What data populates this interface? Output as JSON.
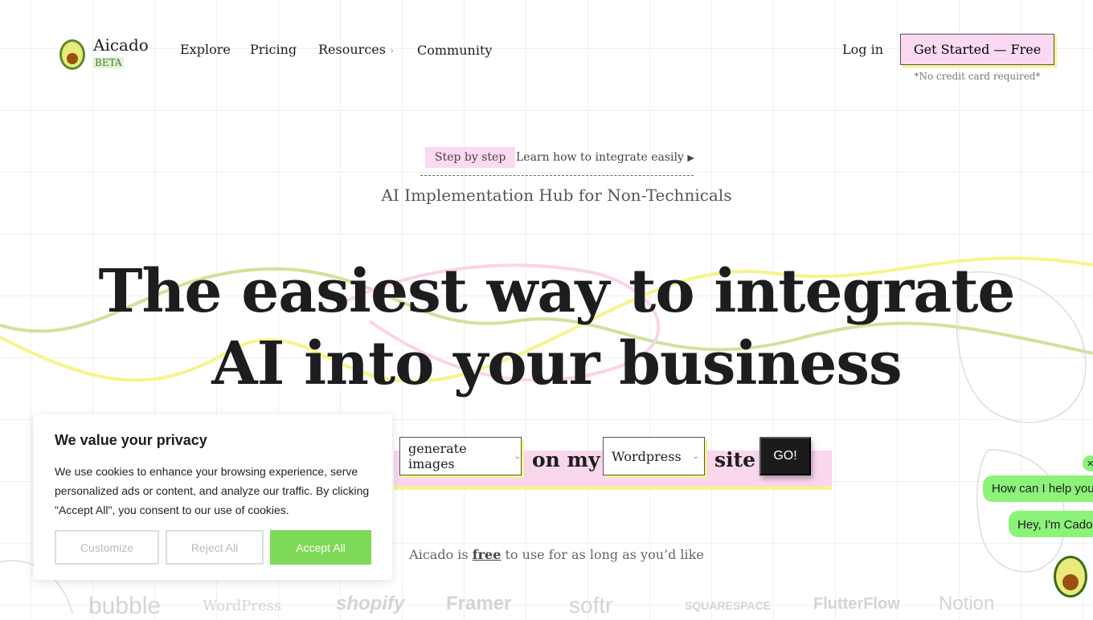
{
  "header": {
    "brand": "Aicado",
    "badge": "BETA",
    "nav": [
      {
        "label": "Explore"
      },
      {
        "label": "Pricing"
      },
      {
        "label": "Resources"
      },
      {
        "label": "Community"
      }
    ],
    "login": "Log in",
    "cta": "Get Started — Free",
    "cta_note": "*No credit card required*"
  },
  "hero": {
    "step_badge": "Step by step",
    "step_link": "Learn how to integrate easily",
    "subtitle": "AI Implementation Hub for Non-Technicals",
    "title_line1": "The easiest way to integrate",
    "title_line2": "AI into your business",
    "builder": {
      "task": "generate images",
      "connector": "on my",
      "platform": "Wordpress",
      "suffix": "site",
      "go": "GO!"
    },
    "free_pre": "Aicado is",
    "free_word": "free",
    "free_post": "to use for as long as you’d like"
  },
  "logos": [
    "bubble",
    "WordPress",
    "shopify",
    "Framer",
    "softr",
    "SQUARESPACE",
    "FlutterFlow",
    "Notion"
  ],
  "cookie": {
    "title": "We value your privacy",
    "body": "We use cookies to enhance your browsing experience, serve personalized ads or content, and analyze our traffic. By clicking \"Accept All\", you consent to our use of cookies.",
    "customize": "Customize",
    "reject": "Reject All",
    "accept": "Accept All"
  },
  "chat": {
    "close": "✕",
    "msg1": "How can I help you?",
    "msg2": "Hey, I'm Cado 👋"
  },
  "colors": {
    "pink": "#fcd9f2",
    "yellow": "#f5f58a",
    "green": "#8cf27a",
    "accept": "#7ed957"
  }
}
